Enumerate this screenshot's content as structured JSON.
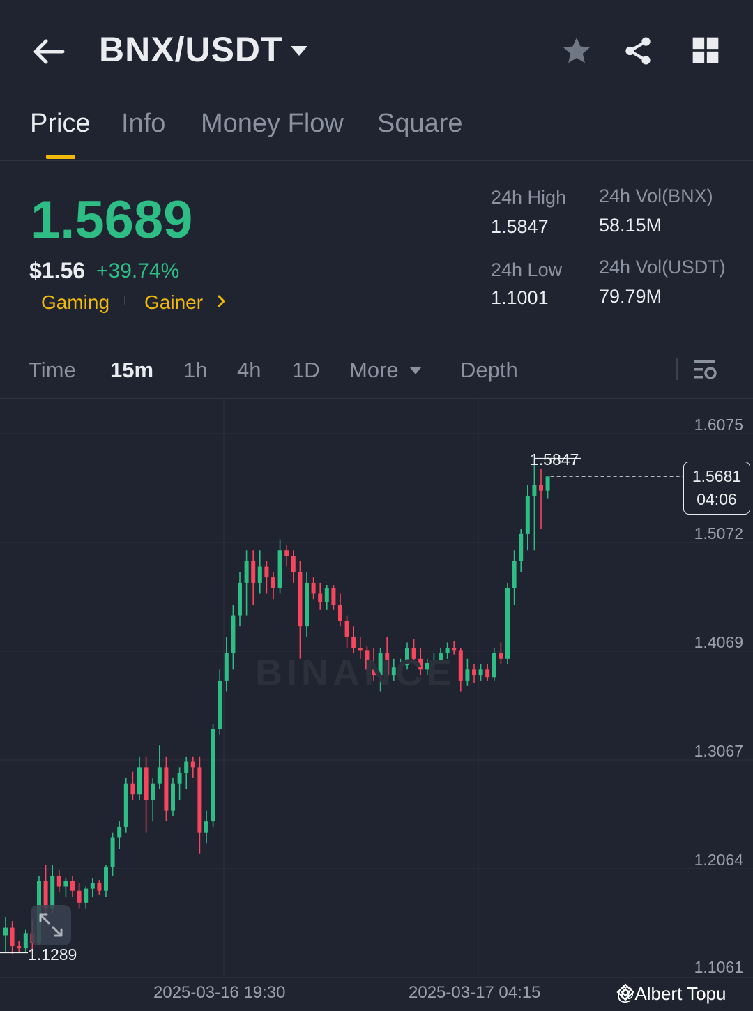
{
  "header": {
    "pair": "BNX/USDT",
    "icons": [
      "back-arrow-icon",
      "caret-down-icon",
      "star-icon",
      "share-icon",
      "grid-icon"
    ]
  },
  "tabs": [
    "Price",
    "Info",
    "Money Flow",
    "Square"
  ],
  "active_tab": "Price",
  "ticker": {
    "last_price": "1.5689",
    "usd_price": "$1.56",
    "change": "+39.74%",
    "tags": [
      "Gaming",
      "Gainer"
    ],
    "high_label": "24h High",
    "high_value": "1.5847",
    "low_label": "24h Low",
    "low_value": "1.1001",
    "vol_base_label": "24h Vol(BNX)",
    "vol_base_value": "58.15M",
    "vol_quote_label": "24h Vol(USDT)",
    "vol_quote_value": "79.79M"
  },
  "intervals": [
    "Time",
    "15m",
    "1h",
    "4h",
    "1D",
    "More",
    "Depth"
  ],
  "active_interval": "15m",
  "colors": {
    "up": "#2ebd85",
    "down": "#f6465d",
    "accent": "#f0b90b",
    "bg": "#1f2430"
  },
  "chart": {
    "watermark": "BINANCE",
    "price_ticks": [
      "1.6075",
      "1.5072",
      "1.4069",
      "1.3067",
      "1.2064",
      "1.1061"
    ],
    "time_ticks": [
      "2025-03-16 19:30",
      "2025-03-17 04:15"
    ],
    "high_marker": "1.5847",
    "low_marker": "1.1289",
    "current_price": "1.5681",
    "countdown": "04:06",
    "credit": "@Albert Topu"
  },
  "chart_data": {
    "type": "candlestick",
    "ylim": [
      1.1061,
      1.6075
    ],
    "high": 1.5847,
    "low": 1.1289,
    "ohlc": [
      [
        1.145,
        1.162,
        1.13,
        1.152
      ],
      [
        1.152,
        1.158,
        1.128,
        1.135
      ],
      [
        1.135,
        1.14,
        1.129,
        1.133
      ],
      [
        1.133,
        1.15,
        1.129,
        1.147
      ],
      [
        1.147,
        1.16,
        1.13,
        1.138
      ],
      [
        1.138,
        1.2,
        1.136,
        1.195
      ],
      [
        1.195,
        1.21,
        1.16,
        1.17
      ],
      [
        1.17,
        1.21,
        1.165,
        1.2
      ],
      [
        1.2,
        1.205,
        1.185,
        1.19
      ],
      [
        1.19,
        1.198,
        1.18,
        1.195
      ],
      [
        1.195,
        1.2,
        1.18,
        1.186
      ],
      [
        1.186,
        1.193,
        1.17,
        1.175
      ],
      [
        1.175,
        1.19,
        1.17,
        1.188
      ],
      [
        1.188,
        1.198,
        1.18,
        1.193
      ],
      [
        1.193,
        1.196,
        1.182,
        1.186
      ],
      [
        1.186,
        1.21,
        1.18,
        1.208
      ],
      [
        1.208,
        1.24,
        1.2,
        1.235
      ],
      [
        1.235,
        1.25,
        1.225,
        1.245
      ],
      [
        1.245,
        1.29,
        1.24,
        1.285
      ],
      [
        1.285,
        1.296,
        1.27,
        1.275
      ],
      [
        1.275,
        1.31,
        1.27,
        1.3
      ],
      [
        1.3,
        1.31,
        1.24,
        1.27
      ],
      [
        1.27,
        1.29,
        1.25,
        1.285
      ],
      [
        1.285,
        1.32,
        1.28,
        1.3
      ],
      [
        1.3,
        1.31,
        1.25,
        1.26
      ],
      [
        1.26,
        1.29,
        1.255,
        1.285
      ],
      [
        1.285,
        1.3,
        1.27,
        1.295
      ],
      [
        1.295,
        1.31,
        1.28,
        1.305
      ],
      [
        1.305,
        1.31,
        1.29,
        1.3
      ],
      [
        1.3,
        1.31,
        1.22,
        1.24
      ],
      [
        1.24,
        1.26,
        1.23,
        1.25
      ],
      [
        1.25,
        1.34,
        1.245,
        1.335
      ],
      [
        1.335,
        1.39,
        1.33,
        1.38
      ],
      [
        1.38,
        1.42,
        1.37,
        1.405
      ],
      [
        1.405,
        1.45,
        1.39,
        1.44
      ],
      [
        1.44,
        1.48,
        1.43,
        1.47
      ],
      [
        1.47,
        1.5,
        1.44,
        1.49
      ],
      [
        1.49,
        1.5,
        1.45,
        1.47
      ],
      [
        1.47,
        1.5,
        1.46,
        1.485
      ],
      [
        1.485,
        1.49,
        1.46,
        1.475
      ],
      [
        1.475,
        1.48,
        1.455,
        1.465
      ],
      [
        1.465,
        1.51,
        1.46,
        1.5
      ],
      [
        1.5,
        1.505,
        1.485,
        1.495
      ],
      [
        1.495,
        1.5,
        1.47,
        1.48
      ],
      [
        1.48,
        1.49,
        1.4,
        1.43
      ],
      [
        1.43,
        1.48,
        1.42,
        1.47
      ],
      [
        1.47,
        1.475,
        1.455,
        1.46
      ],
      [
        1.46,
        1.47,
        1.445,
        1.452
      ],
      [
        1.452,
        1.468,
        1.445,
        1.465
      ],
      [
        1.465,
        1.468,
        1.445,
        1.45
      ],
      [
        1.45,
        1.46,
        1.43,
        1.435
      ],
      [
        1.435,
        1.44,
        1.41,
        1.42
      ],
      [
        1.42,
        1.43,
        1.405,
        1.41
      ],
      [
        1.41,
        1.42,
        1.4,
        1.408
      ],
      [
        1.408,
        1.412,
        1.385,
        1.39
      ],
      [
        1.39,
        1.41,
        1.38,
        1.385
      ],
      [
        1.385,
        1.41,
        1.37,
        1.405
      ],
      [
        1.405,
        1.42,
        1.38,
        1.385
      ],
      [
        1.385,
        1.4,
        1.38,
        1.392
      ],
      [
        1.392,
        1.4,
        1.39,
        1.394
      ],
      [
        1.394,
        1.415,
        1.39,
        1.41
      ],
      [
        1.41,
        1.418,
        1.395,
        1.4
      ],
      [
        1.4,
        1.41,
        1.385,
        1.39
      ],
      [
        1.39,
        1.4,
        1.385,
        1.396
      ],
      [
        1.396,
        1.405,
        1.392,
        1.398
      ],
      [
        1.398,
        1.41,
        1.395,
        1.405
      ],
      [
        1.405,
        1.415,
        1.4,
        1.41
      ],
      [
        1.41,
        1.416,
        1.404,
        1.408
      ],
      [
        1.408,
        1.41,
        1.37,
        1.38
      ],
      [
        1.38,
        1.4,
        1.375,
        1.39
      ],
      [
        1.39,
        1.395,
        1.378,
        1.385
      ],
      [
        1.385,
        1.395,
        1.38,
        1.39
      ],
      [
        1.39,
        1.395,
        1.38,
        1.383
      ],
      [
        1.383,
        1.41,
        1.38,
        1.405
      ],
      [
        1.405,
        1.415,
        1.395,
        1.4
      ],
      [
        1.4,
        1.47,
        1.395,
        1.465
      ],
      [
        1.465,
        1.5,
        1.45,
        1.49
      ],
      [
        1.49,
        1.52,
        1.48,
        1.515
      ],
      [
        1.515,
        1.56,
        1.5,
        1.55
      ],
      [
        1.55,
        1.585,
        1.5,
        1.56
      ],
      [
        1.56,
        1.575,
        1.52,
        1.555
      ],
      [
        1.555,
        1.568,
        1.548,
        1.5681
      ]
    ]
  }
}
